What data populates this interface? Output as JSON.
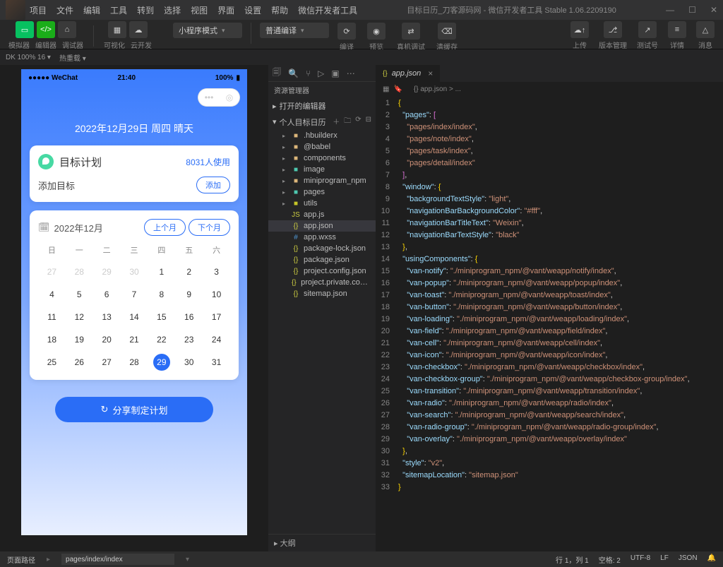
{
  "window": {
    "title": "目标日历_刀客源码网 - 微信开发者工具 Stable 1.06.2209190",
    "product": "微信开发者工具"
  },
  "menubar": [
    "项目",
    "文件",
    "编辑",
    "工具",
    "转到",
    "选择",
    "视图",
    "界面",
    "设置",
    "帮助",
    "微信开发者工具"
  ],
  "toolbar": {
    "simulator_label": "模拟器",
    "editor_label": "编辑器",
    "debugger_label": "调试器",
    "visual_label": "可视化",
    "cloud_label": "云开发",
    "mode": "小程序模式",
    "compile": "普通编译",
    "compile_label": "编译",
    "preview_label": "预览",
    "realdevice_label": "真机调试",
    "clearcache_label": "清缓存",
    "upload_label": "上传",
    "version_label": "版本管理",
    "testid_label": "测试号",
    "detail_label": "详情",
    "msg_label": "消息"
  },
  "subbar": {
    "zoom": "DK 100% 16 ▾",
    "hot": "热重载 ▾"
  },
  "phone": {
    "wechat": "●●●●● WeChat",
    "time": "21:40",
    "battery": "100%",
    "date_title": "2022年12月29日 周四 晴天",
    "card_title": "目标计划",
    "card_users": "8031人使用",
    "add_label": "添加目标",
    "add_btn": "添加",
    "cal_title": "2022年12月",
    "prev_month": "上个月",
    "next_month": "下个月",
    "share": "分享制定计划",
    "dow": [
      "日",
      "一",
      "二",
      "三",
      "四",
      "五",
      "六"
    ],
    "days": [
      {
        "n": "27",
        "dim": true
      },
      {
        "n": "28",
        "dim": true
      },
      {
        "n": "29",
        "dim": true
      },
      {
        "n": "30",
        "dim": true
      },
      {
        "n": "1"
      },
      {
        "n": "2"
      },
      {
        "n": "3"
      },
      {
        "n": "4"
      },
      {
        "n": "5"
      },
      {
        "n": "6"
      },
      {
        "n": "7"
      },
      {
        "n": "8"
      },
      {
        "n": "9"
      },
      {
        "n": "10"
      },
      {
        "n": "11"
      },
      {
        "n": "12"
      },
      {
        "n": "13"
      },
      {
        "n": "14"
      },
      {
        "n": "15"
      },
      {
        "n": "16"
      },
      {
        "n": "17"
      },
      {
        "n": "18"
      },
      {
        "n": "19"
      },
      {
        "n": "20"
      },
      {
        "n": "21"
      },
      {
        "n": "22"
      },
      {
        "n": "23"
      },
      {
        "n": "24"
      },
      {
        "n": "25"
      },
      {
        "n": "26"
      },
      {
        "n": "27"
      },
      {
        "n": "28"
      },
      {
        "n": "29",
        "today": true
      },
      {
        "n": "30"
      },
      {
        "n": "31"
      }
    ]
  },
  "explorer": {
    "title": "资源管理器",
    "section_editors": "打开的编辑器",
    "section_project": "个人目标日历",
    "items": [
      {
        "name": ".hbuilderx",
        "type": "folder"
      },
      {
        "name": "@babel",
        "type": "folder"
      },
      {
        "name": "components",
        "type": "folder"
      },
      {
        "name": "image",
        "type": "folder",
        "color": "#4ec9b0"
      },
      {
        "name": "miniprogram_npm",
        "type": "folder"
      },
      {
        "name": "pages",
        "type": "folder",
        "color": "#4ec9b0"
      },
      {
        "name": "utils",
        "type": "folder",
        "color": "#c5c528"
      },
      {
        "name": "app.js",
        "type": "file",
        "icon": "JS",
        "color": "#cbcb41"
      },
      {
        "name": "app.json",
        "type": "file",
        "icon": "{}",
        "color": "#cbcb41",
        "selected": true
      },
      {
        "name": "app.wxss",
        "type": "file",
        "icon": "#",
        "color": "#5098d6"
      },
      {
        "name": "package-lock.json",
        "type": "file",
        "icon": "{}",
        "color": "#cbcb41"
      },
      {
        "name": "package.json",
        "type": "file",
        "icon": "{}",
        "color": "#cbcb41"
      },
      {
        "name": "project.config.json",
        "type": "file",
        "icon": "{}",
        "color": "#cbcb41"
      },
      {
        "name": "project.private.config.js...",
        "type": "file",
        "icon": "{}",
        "color": "#cbcb41"
      },
      {
        "name": "sitemap.json",
        "type": "file",
        "icon": "{}",
        "color": "#cbcb41"
      }
    ],
    "outline": "大纲"
  },
  "editor": {
    "tab_name": "app.json",
    "breadcrumb": "{} app.json > ...",
    "lines": [
      {
        "n": 1,
        "t": [
          {
            "c": "brace",
            "v": "{"
          }
        ]
      },
      {
        "n": 2,
        "t": [
          {
            "c": "",
            "v": "  "
          },
          {
            "c": "key",
            "v": "\"pages\""
          },
          {
            "c": "pun",
            "v": ": "
          },
          {
            "c": "bracket",
            "v": "["
          }
        ]
      },
      {
        "n": 3,
        "t": [
          {
            "c": "",
            "v": "    "
          },
          {
            "c": "str",
            "v": "\"pages/index/index\""
          },
          {
            "c": "pun",
            "v": ","
          }
        ]
      },
      {
        "n": 4,
        "t": [
          {
            "c": "",
            "v": "    "
          },
          {
            "c": "str",
            "v": "\"pages/note/index\""
          },
          {
            "c": "pun",
            "v": ","
          }
        ]
      },
      {
        "n": 5,
        "t": [
          {
            "c": "",
            "v": "    "
          },
          {
            "c": "str",
            "v": "\"pages/task/index\""
          },
          {
            "c": "pun",
            "v": ","
          }
        ]
      },
      {
        "n": 6,
        "t": [
          {
            "c": "",
            "v": "    "
          },
          {
            "c": "str",
            "v": "\"pages/detail/index\""
          }
        ]
      },
      {
        "n": 7,
        "t": [
          {
            "c": "",
            "v": "  "
          },
          {
            "c": "bracket",
            "v": "]"
          },
          {
            "c": "pun",
            "v": ","
          }
        ]
      },
      {
        "n": 8,
        "t": [
          {
            "c": "",
            "v": "  "
          },
          {
            "c": "key",
            "v": "\"window\""
          },
          {
            "c": "pun",
            "v": ": "
          },
          {
            "c": "brace",
            "v": "{"
          }
        ]
      },
      {
        "n": 9,
        "t": [
          {
            "c": "",
            "v": "    "
          },
          {
            "c": "key",
            "v": "\"backgroundTextStyle\""
          },
          {
            "c": "pun",
            "v": ": "
          },
          {
            "c": "str",
            "v": "\"light\""
          },
          {
            "c": "pun",
            "v": ","
          }
        ]
      },
      {
        "n": 10,
        "t": [
          {
            "c": "",
            "v": "    "
          },
          {
            "c": "key",
            "v": "\"navigationBarBackgroundColor\""
          },
          {
            "c": "pun",
            "v": ": "
          },
          {
            "c": "str",
            "v": "\"#fff\""
          },
          {
            "c": "pun",
            "v": ","
          }
        ]
      },
      {
        "n": 11,
        "t": [
          {
            "c": "",
            "v": "    "
          },
          {
            "c": "key",
            "v": "\"navigationBarTitleText\""
          },
          {
            "c": "pun",
            "v": ": "
          },
          {
            "c": "str",
            "v": "\"Weixin\""
          },
          {
            "c": "pun",
            "v": ","
          }
        ]
      },
      {
        "n": 12,
        "t": [
          {
            "c": "",
            "v": "    "
          },
          {
            "c": "key",
            "v": "\"navigationBarTextStyle\""
          },
          {
            "c": "pun",
            "v": ": "
          },
          {
            "c": "str",
            "v": "\"black\""
          }
        ]
      },
      {
        "n": 13,
        "t": [
          {
            "c": "",
            "v": "  "
          },
          {
            "c": "brace",
            "v": "}"
          },
          {
            "c": "pun",
            "v": ","
          }
        ]
      },
      {
        "n": 14,
        "t": [
          {
            "c": "",
            "v": "  "
          },
          {
            "c": "key",
            "v": "\"usingComponents\""
          },
          {
            "c": "pun",
            "v": ": "
          },
          {
            "c": "brace",
            "v": "{"
          }
        ]
      },
      {
        "n": 15,
        "t": [
          {
            "c": "",
            "v": "    "
          },
          {
            "c": "key",
            "v": "\"van-notify\""
          },
          {
            "c": "pun",
            "v": ": "
          },
          {
            "c": "str",
            "v": "\"./miniprogram_npm/@vant/weapp/notify/index\""
          },
          {
            "c": "pun",
            "v": ","
          }
        ]
      },
      {
        "n": 16,
        "t": [
          {
            "c": "",
            "v": "    "
          },
          {
            "c": "key",
            "v": "\"van-popup\""
          },
          {
            "c": "pun",
            "v": ": "
          },
          {
            "c": "str",
            "v": "\"./miniprogram_npm/@vant/weapp/popup/index\""
          },
          {
            "c": "pun",
            "v": ","
          }
        ]
      },
      {
        "n": 17,
        "t": [
          {
            "c": "",
            "v": "    "
          },
          {
            "c": "key",
            "v": "\"van-toast\""
          },
          {
            "c": "pun",
            "v": ": "
          },
          {
            "c": "str",
            "v": "\"./miniprogram_npm/@vant/weapp/toast/index\""
          },
          {
            "c": "pun",
            "v": ","
          }
        ]
      },
      {
        "n": 18,
        "t": [
          {
            "c": "",
            "v": "    "
          },
          {
            "c": "key",
            "v": "\"van-button\""
          },
          {
            "c": "pun",
            "v": ": "
          },
          {
            "c": "str",
            "v": "\"./miniprogram_npm/@vant/weapp/button/index\""
          },
          {
            "c": "pun",
            "v": ","
          }
        ]
      },
      {
        "n": 19,
        "t": [
          {
            "c": "",
            "v": "    "
          },
          {
            "c": "key",
            "v": "\"van-loading\""
          },
          {
            "c": "pun",
            "v": ": "
          },
          {
            "c": "str",
            "v": "\"./miniprogram_npm/@vant/weapp/loading/index\""
          },
          {
            "c": "pun",
            "v": ","
          }
        ]
      },
      {
        "n": 20,
        "t": [
          {
            "c": "",
            "v": "    "
          },
          {
            "c": "key",
            "v": "\"van-field\""
          },
          {
            "c": "pun",
            "v": ": "
          },
          {
            "c": "str",
            "v": "\"./miniprogram_npm/@vant/weapp/field/index\""
          },
          {
            "c": "pun",
            "v": ","
          }
        ]
      },
      {
        "n": 21,
        "t": [
          {
            "c": "",
            "v": "    "
          },
          {
            "c": "key",
            "v": "\"van-cell\""
          },
          {
            "c": "pun",
            "v": ": "
          },
          {
            "c": "str",
            "v": "\"./miniprogram_npm/@vant/weapp/cell/index\""
          },
          {
            "c": "pun",
            "v": ","
          }
        ]
      },
      {
        "n": 22,
        "t": [
          {
            "c": "",
            "v": "    "
          },
          {
            "c": "key",
            "v": "\"van-icon\""
          },
          {
            "c": "pun",
            "v": ": "
          },
          {
            "c": "str",
            "v": "\"./miniprogram_npm/@vant/weapp/icon/index\""
          },
          {
            "c": "pun",
            "v": ","
          }
        ]
      },
      {
        "n": 23,
        "t": [
          {
            "c": "",
            "v": "    "
          },
          {
            "c": "key",
            "v": "\"van-checkbox\""
          },
          {
            "c": "pun",
            "v": ": "
          },
          {
            "c": "str",
            "v": "\"./miniprogram_npm/@vant/weapp/checkbox/index\""
          },
          {
            "c": "pun",
            "v": ","
          }
        ]
      },
      {
        "n": 24,
        "t": [
          {
            "c": "",
            "v": "    "
          },
          {
            "c": "key",
            "v": "\"van-checkbox-group\""
          },
          {
            "c": "pun",
            "v": ": "
          },
          {
            "c": "str",
            "v": "\"./miniprogram_npm/@vant/weapp/checkbox-group/index\""
          },
          {
            "c": "pun",
            "v": ","
          }
        ]
      },
      {
        "n": 25,
        "t": [
          {
            "c": "",
            "v": "    "
          },
          {
            "c": "key",
            "v": "\"van-transition\""
          },
          {
            "c": "pun",
            "v": ": "
          },
          {
            "c": "str",
            "v": "\"./miniprogram_npm/@vant/weapp/transition/index\""
          },
          {
            "c": "pun",
            "v": ","
          }
        ]
      },
      {
        "n": 26,
        "t": [
          {
            "c": "",
            "v": "    "
          },
          {
            "c": "key",
            "v": "\"van-radio\""
          },
          {
            "c": "pun",
            "v": ": "
          },
          {
            "c": "str",
            "v": "\"./miniprogram_npm/@vant/weapp/radio/index\""
          },
          {
            "c": "pun",
            "v": ","
          }
        ]
      },
      {
        "n": 27,
        "t": [
          {
            "c": "",
            "v": "    "
          },
          {
            "c": "key",
            "v": "\"van-search\""
          },
          {
            "c": "pun",
            "v": ": "
          },
          {
            "c": "str",
            "v": "\"./miniprogram_npm/@vant/weapp/search/index\""
          },
          {
            "c": "pun",
            "v": ","
          }
        ]
      },
      {
        "n": 28,
        "t": [
          {
            "c": "",
            "v": "    "
          },
          {
            "c": "key",
            "v": "\"van-radio-group\""
          },
          {
            "c": "pun",
            "v": ": "
          },
          {
            "c": "str",
            "v": "\"./miniprogram_npm/@vant/weapp/radio-group/index\""
          },
          {
            "c": "pun",
            "v": ","
          }
        ]
      },
      {
        "n": 29,
        "t": [
          {
            "c": "",
            "v": "    "
          },
          {
            "c": "key",
            "v": "\"van-overlay\""
          },
          {
            "c": "pun",
            "v": ": "
          },
          {
            "c": "str",
            "v": "\"./miniprogram_npm/@vant/weapp/overlay/index\""
          }
        ]
      },
      {
        "n": 30,
        "t": [
          {
            "c": "",
            "v": "  "
          },
          {
            "c": "brace",
            "v": "}"
          },
          {
            "c": "pun",
            "v": ","
          }
        ]
      },
      {
        "n": 31,
        "t": [
          {
            "c": "",
            "v": "  "
          },
          {
            "c": "key",
            "v": "\"style\""
          },
          {
            "c": "pun",
            "v": ": "
          },
          {
            "c": "str",
            "v": "\"v2\""
          },
          {
            "c": "pun",
            "v": ","
          }
        ]
      },
      {
        "n": 32,
        "t": [
          {
            "c": "",
            "v": "  "
          },
          {
            "c": "key",
            "v": "\"sitemapLocation\""
          },
          {
            "c": "pun",
            "v": ": "
          },
          {
            "c": "str",
            "v": "\"sitemap.json\""
          }
        ]
      },
      {
        "n": 33,
        "t": [
          {
            "c": "brace",
            "v": "}"
          }
        ]
      }
    ]
  },
  "footer": {
    "path_label": "页面路径",
    "path_value": "pages/index/index",
    "line": "行 1，列 1",
    "spaces": "空格: 2",
    "encoding": "UTF-8",
    "eol": "LF",
    "lang": "JSON"
  }
}
